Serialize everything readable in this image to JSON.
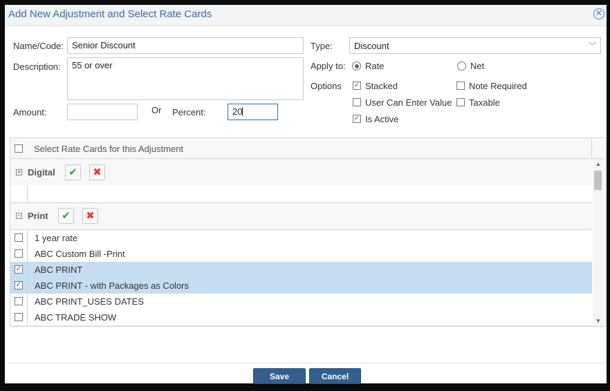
{
  "dialog": {
    "title": "Add New Adjustment and Select Rate Cards",
    "close_icon": "close-circle-icon"
  },
  "form": {
    "name_label": "Name/Code:",
    "name_value": "Senior Discount",
    "description_label": "Description:",
    "description_value": "55 or over",
    "amount_label": "Amount:",
    "amount_value": "",
    "or_label": "Or",
    "percent_label": "Percent:",
    "percent_value": "20",
    "type_label": "Type:",
    "type_value": "Discount",
    "apply_label": "Apply to:",
    "apply_options": [
      {
        "label": "Rate",
        "selected": true
      },
      {
        "label": "Net",
        "selected": false
      }
    ],
    "options_label": "Options",
    "options": {
      "stacked": {
        "label": "Stacked",
        "checked": true
      },
      "note_required": {
        "label": "Note Required",
        "checked": false
      },
      "user_can_enter_value": {
        "label": "User Can Enter Value",
        "checked": false
      },
      "taxable": {
        "label": "Taxable",
        "checked": false
      },
      "is_active": {
        "label": "Is Active",
        "checked": true
      }
    }
  },
  "grid": {
    "header_label": "Select Rate Cards for this Adjustment",
    "groups": [
      {
        "name": "Digital",
        "expanded": false
      },
      {
        "name": "Print",
        "expanded": true
      }
    ],
    "rows": [
      {
        "label": "1 year rate",
        "checked": false
      },
      {
        "label": "ABC Custom Bill -Print",
        "checked": false
      },
      {
        "label": "ABC PRINT",
        "checked": true
      },
      {
        "label": "ABC PRINT - with Packages as Colors",
        "checked": true
      },
      {
        "label": "ABC PRINT_USES DATES",
        "checked": false
      },
      {
        "label": "ABC TRADE SHOW",
        "checked": false
      }
    ]
  },
  "footer": {
    "save_label": "Save",
    "cancel_label": "Cancel"
  },
  "colors": {
    "title": "#3a6ea5",
    "button": "#335f8f",
    "selected_row": "#c6dcf0"
  }
}
